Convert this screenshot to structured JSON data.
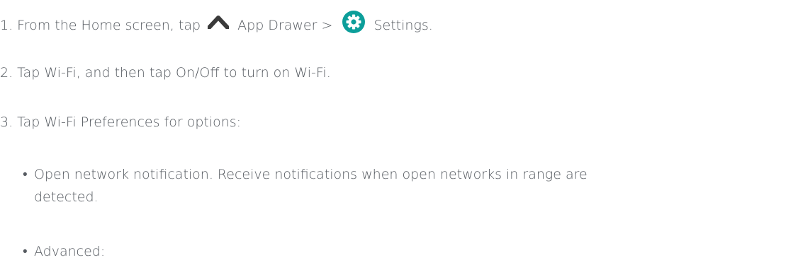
{
  "steps": [
    {
      "before": "1. From the Home screen, tap",
      "icon1": "chevron-up-icon",
      "middle": "App Drawer >",
      "icon2": "settings-gear-icon",
      "after": "Settings."
    },
    {
      "text": "2. Tap Wi-Fi, and then tap On/Off to turn on Wi-Fi."
    },
    {
      "text": "3. Tap Wi-Fi Preferences for options:"
    }
  ],
  "bullets": [
    {
      "marker": "•",
      "line1": "Open network notification. Receive notifications when open networks in range are",
      "line2": "detected."
    },
    {
      "marker": "•",
      "line1": "Advanced:"
    }
  ],
  "colors": {
    "text": "#555a60",
    "caret": "#3a3a3a",
    "gear": "#0c9e9a"
  }
}
